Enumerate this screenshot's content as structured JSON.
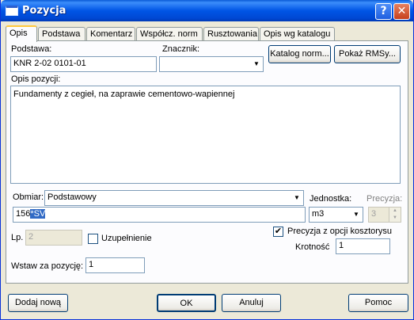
{
  "window": {
    "title": "Pozycja"
  },
  "titlebar": {
    "help_glyph": "?",
    "close_glyph": "✕"
  },
  "tabs": [
    {
      "label": "Opis"
    },
    {
      "label": "Podstawa"
    },
    {
      "label": "Komentarz"
    },
    {
      "label": "Współcz. norm"
    },
    {
      "label": "Rusztowania"
    },
    {
      "label": "Opis wg katalogu"
    }
  ],
  "podstawa": {
    "label": "Podstawa:",
    "value": "KNR 2-02 0101-01"
  },
  "znacznik": {
    "label": "Znacznik:",
    "value": ""
  },
  "buttons": {
    "katalog": "Katalog norm...",
    "pokaz": "Pokaż RMSy...",
    "dodaj": "Dodaj nową",
    "ok": "OK",
    "anuluj": "Anuluj",
    "pomoc": "Pomoc"
  },
  "opis": {
    "label": "Opis pozycji:",
    "value": "Fundamenty z cegieł, na zaprawie cementowo-wapiennej"
  },
  "obmiar": {
    "label": "Obmiar:",
    "value": "Podstawowy",
    "expr_num": "156",
    "expr_sel": "*SV"
  },
  "jednostka": {
    "label": "Jednostka:",
    "value": "m3"
  },
  "precyzja": {
    "label": "Precyzja:",
    "value": "3"
  },
  "lp": {
    "label": "Lp.",
    "value": "2"
  },
  "uzupelnienie": {
    "label": "Uzupełnienie",
    "checked": false
  },
  "precyzja_opcji": {
    "label": "Precyzja z opcji kosztorysu",
    "checked": true,
    "check_glyph": "✔"
  },
  "krotnosc": {
    "label": "Krotność",
    "value": "1"
  },
  "wstaw": {
    "label": "Wstaw za pozycję:",
    "value": "1"
  }
}
